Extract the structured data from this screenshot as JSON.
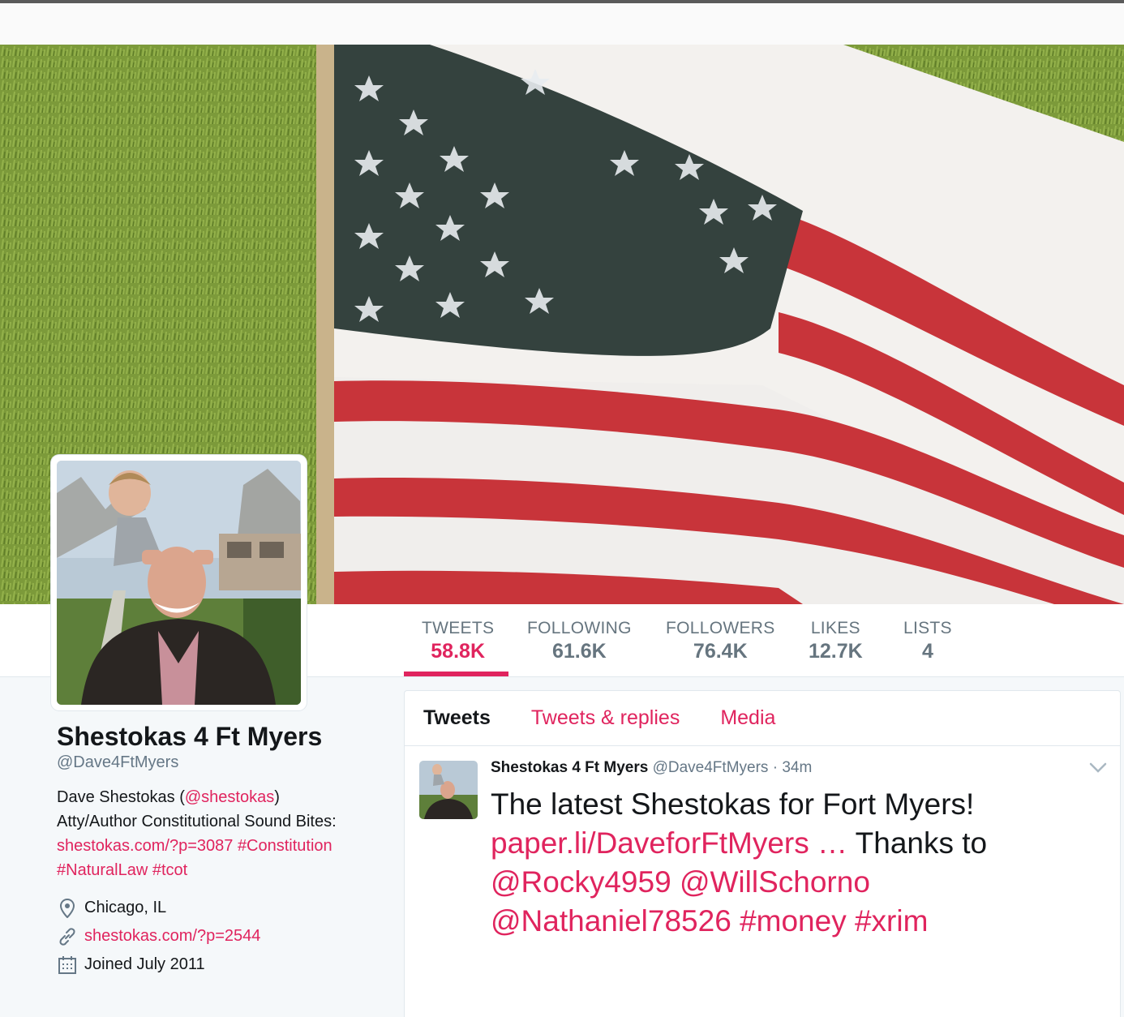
{
  "profile": {
    "display_name": "Shestokas 4 Ft Myers",
    "handle": "@Dave4FtMyers",
    "bio_line1_prefix": "Dave Shestokas (",
    "bio_line1_mention": "@shestokas",
    "bio_line1_suffix": ")",
    "bio_line2": "Atty/Author Constitutional Sound Bites:",
    "bio_link": "shestokas.com/?p=3087",
    "bio_tag1": "#Constitution",
    "bio_tag2": "#NaturalLaw",
    "bio_tag3": "#tcot",
    "location": "Chicago, IL",
    "website": "shestokas.com/?p=2544",
    "joined": "Joined July 2011"
  },
  "stats": [
    {
      "label": "TWEETS",
      "value": "58.8K",
      "active": true
    },
    {
      "label": "FOLLOWING",
      "value": "61.6K"
    },
    {
      "label": "FOLLOWERS",
      "value": "76.4K"
    },
    {
      "label": "LIKES",
      "value": "12.7K"
    },
    {
      "label": "LISTS",
      "value": "4"
    }
  ],
  "tabs": {
    "tweets": "Tweets",
    "tweets_replies": "Tweets & replies",
    "media": "Media"
  },
  "tweet": {
    "author_name": "Shestokas 4 Ft Myers",
    "author_handle": "@Dave4FtMyers",
    "separator": "·",
    "time": "34m",
    "text_intro": "The latest Shestokas for Fort Myers! ",
    "link": "paper.li/DaveforFtMyers  …",
    "text_thanks": " Thanks to ",
    "mention1": "@Rocky4959",
    "mention2": "@WillSchorno",
    "mention3": "@Nathaniel78526",
    "hashtag1": "#money",
    "hashtag2": "#xrim"
  },
  "icons": {
    "location": "map-pin-icon",
    "website": "link-icon",
    "joined": "calendar-icon",
    "tweet_menu": "chevron-down-icon"
  },
  "colors": {
    "accent": "#e0245e",
    "secondary_text": "#657786"
  }
}
